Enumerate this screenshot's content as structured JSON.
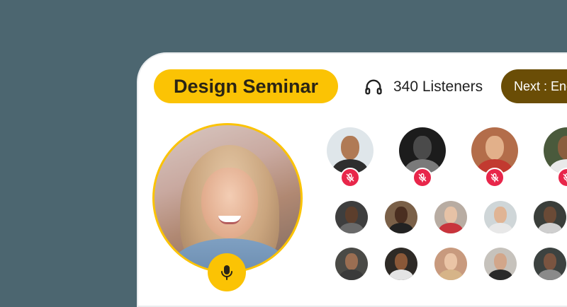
{
  "header": {
    "title": "Design Seminar",
    "listeners_icon": "headphones-icon",
    "listeners_label": "340 Listeners",
    "next_label": "Next : English Debate"
  },
  "host": {
    "mic_icon": "microphone-icon",
    "mic_color": "#fbc304"
  },
  "speakers": [
    {
      "name": "speaker-1",
      "muted": true
    },
    {
      "name": "speaker-2",
      "muted": true
    },
    {
      "name": "speaker-3",
      "muted": true
    },
    {
      "name": "speaker-4",
      "muted": true
    }
  ],
  "colors": {
    "background": "#4c6670",
    "accent": "#fbc304",
    "next_pill": "#6a4d06",
    "mute": "#e8264a"
  }
}
